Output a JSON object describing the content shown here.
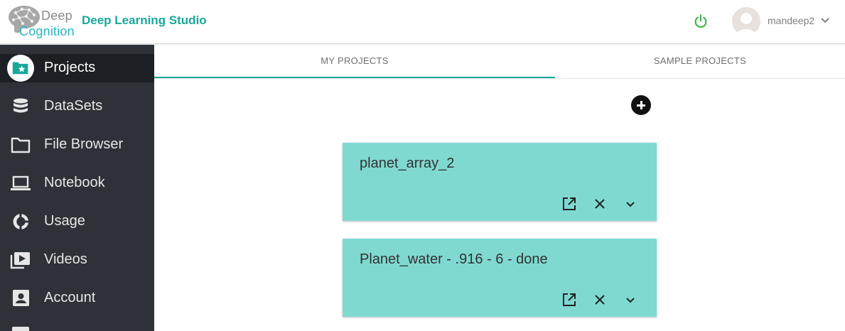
{
  "header": {
    "logo_word1": "Deep",
    "logo_word2": "Cognition",
    "brand": "Deep Learning Studio",
    "username": "mandeep2",
    "icons": {
      "power": "power-icon",
      "user_menu": "chevron-down-icon"
    },
    "colors": {
      "brand": "#18a89a",
      "power": "#3cb44b",
      "logo_accent": "#29b7c9"
    }
  },
  "sidebar": {
    "items": [
      {
        "label": "Projects",
        "icon": "folder-star-icon",
        "active": true
      },
      {
        "label": "DataSets",
        "icon": "database-icon"
      },
      {
        "label": "File Browser",
        "icon": "folder-icon"
      },
      {
        "label": "Notebook",
        "icon": "laptop-icon"
      },
      {
        "label": "Usage",
        "icon": "donut-chart-icon"
      },
      {
        "label": "Videos",
        "icon": "video-library-icon"
      },
      {
        "label": "Account",
        "icon": "account-box-icon"
      }
    ]
  },
  "tabs": [
    {
      "label": "MY PROJECTS",
      "active": true
    },
    {
      "label": "SAMPLE PROJECTS",
      "active": false
    }
  ],
  "projects": [
    {
      "name": "planet_array_2"
    },
    {
      "name": "Planet_water - .916 - 6 - done"
    }
  ],
  "project_actions": [
    "open-external-icon",
    "close-icon",
    "chevron-down-icon"
  ],
  "colors": {
    "card": "#7fd9d1",
    "sidebar": "#2e3238",
    "sidebar_active": "#1c1f23",
    "tab_accent": "#18a89a"
  }
}
